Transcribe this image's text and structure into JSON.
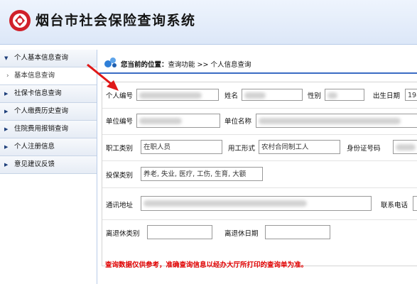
{
  "header": {
    "title": "烟台市社会保险查询系统"
  },
  "sidebar": {
    "items": [
      {
        "label": "个人基本信息查询",
        "expanded": true,
        "children": [
          {
            "label": "基本信息查询"
          }
        ]
      },
      {
        "label": "社保卡信息查询"
      },
      {
        "label": "个人缴费历史查询"
      },
      {
        "label": "住院费用报销查询"
      },
      {
        "label": "个人注册信息"
      },
      {
        "label": "意见建议反馈"
      }
    ]
  },
  "breadcrumb": {
    "prefix": "您当前的位置：",
    "path": "查询功能 >> 个人信息查询"
  },
  "form": {
    "personal_id": {
      "label": "个人编号",
      "value": ""
    },
    "name": {
      "label": "姓名",
      "value": ""
    },
    "gender": {
      "label": "性别",
      "value": ""
    },
    "birth_date": {
      "label": "出生日期",
      "value": "198"
    },
    "unit_id": {
      "label": "单位编号",
      "value": ""
    },
    "unit_name": {
      "label": "单位名称",
      "value": ""
    },
    "staff_type": {
      "label": "职工类别",
      "value": "在职人员"
    },
    "employment_form": {
      "label": "用工形式",
      "value": "农村合同制工人"
    },
    "id_number": {
      "label": "身份证号码",
      "value": ""
    },
    "insurance_type": {
      "label": "投保类别",
      "value": "养老, 失业, 医疗, 工伤, 生育, 大额"
    },
    "address": {
      "label": "通讯地址",
      "value": ""
    },
    "phone": {
      "label": "联系电话",
      "value": ""
    },
    "retire_type": {
      "label": "离退休类别",
      "value": ""
    },
    "retire_date": {
      "label": "离退休日期",
      "value": ""
    }
  },
  "main": {
    "note": "查询数据仅供参考，准确查询信息以经办大厅所打印的查询单为准。"
  },
  "colors": {
    "accent": "#3a6cc4",
    "logo_red": "#d0202a",
    "note_red": "#e00000"
  }
}
